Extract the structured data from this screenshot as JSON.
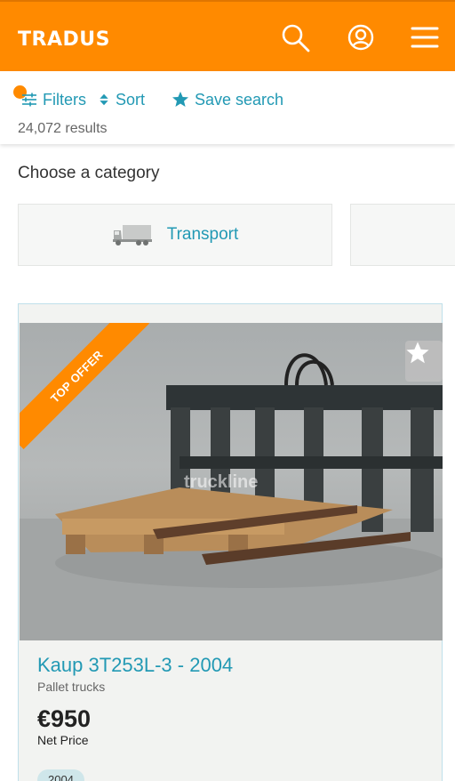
{
  "header": {
    "logo": "TRADUS",
    "icons": [
      "search-icon",
      "user-icon",
      "menu-icon"
    ],
    "color": "#ff8a00"
  },
  "toolbar": {
    "filters_label": "Filters",
    "sort_label": "Sort",
    "save_search_label": "Save search",
    "results_text": "24,072 results",
    "accent": "#2299b4"
  },
  "categories": {
    "title": "Choose a category",
    "items": [
      {
        "label": "Transport",
        "icon": "truck-icon"
      },
      {
        "label": "",
        "icon": ""
      }
    ]
  },
  "listing": {
    "badge": "TOP OFFER",
    "watermark": "truckline",
    "title": "Kaup 3T253L-3 - 2004",
    "category": "Pallet trucks",
    "price": "€950",
    "price_note": "Net Price",
    "year": "2004",
    "fav_icon": "star-icon"
  }
}
